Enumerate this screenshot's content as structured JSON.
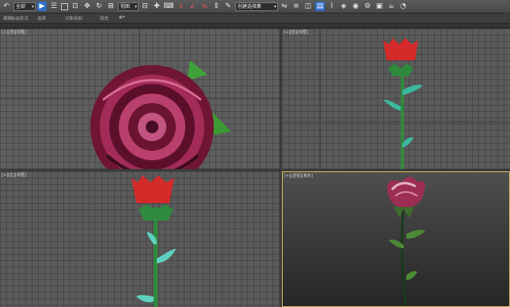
{
  "toolbar": {
    "selection_filter": "全部",
    "ref_coord": "视图",
    "named_selection": "创建选择集",
    "coord_indicator": "3"
  },
  "ribbon": {
    "items": [
      "建模",
      "自由形式",
      "选择",
      "对象绘制",
      "填充"
    ]
  },
  "viewports": {
    "top": "[+][顶][线框]",
    "front": "[+][前][线框]",
    "left": "[+][左][线框]",
    "perspective": "[+][透视][真实]"
  },
  "colors": {
    "viewport_bg": "#5e5e5e",
    "active_border": "#e2c060",
    "rose_red": "#b0204a",
    "stem_green": "#2e8a3d"
  }
}
